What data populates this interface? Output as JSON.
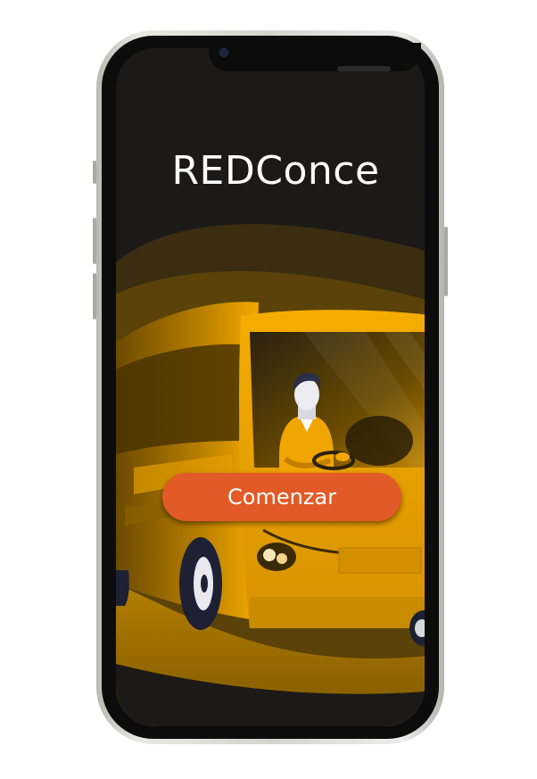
{
  "app": {
    "title": "REDConce",
    "start_button_label": "Comenzar"
  },
  "illustration": {
    "subject": "bus-driver-illustration",
    "colors": {
      "background": "#1b1a18",
      "bus_yellow": "#f2a800",
      "bus_dark": "#7a5400",
      "button": "#e25a27",
      "ground": "#9a7000"
    }
  }
}
